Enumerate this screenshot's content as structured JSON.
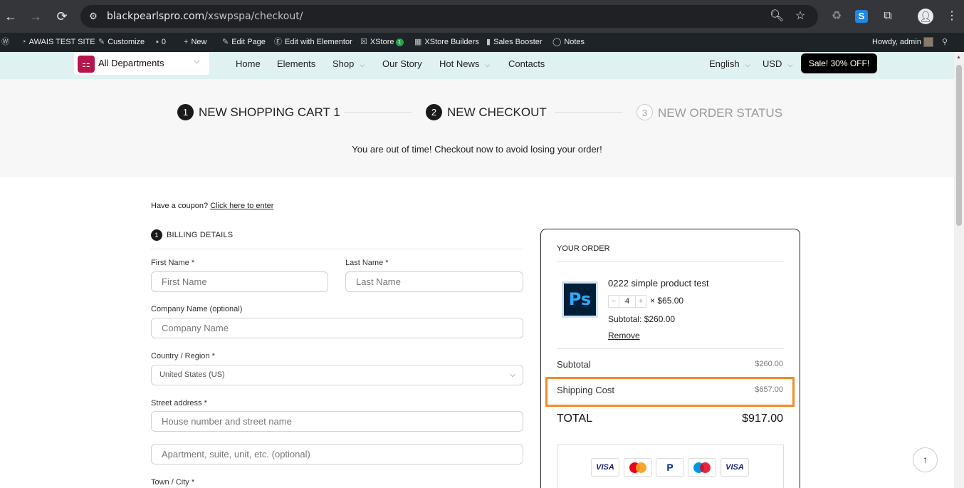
{
  "browser": {
    "url_host": "blackpearlspro.com",
    "url_path": "/xswpspa/checkout/"
  },
  "adminbar": {
    "site": "AWAIS TEST SITE",
    "customize": "Customize",
    "comments": "0",
    "new": "New",
    "edit_page": "Edit Page",
    "edit_elementor": "Edit with Elementor",
    "xstore": "XStore",
    "xstore_badge": "1",
    "builders": "XStore Builders",
    "sales_booster": "Sales Booster",
    "notes": "Notes",
    "howdy": "Howdy, admin"
  },
  "header": {
    "departments": "All Departments",
    "menu": [
      {
        "label": "Home",
        "dropdown": false
      },
      {
        "label": "Elements",
        "dropdown": false
      },
      {
        "label": "Shop",
        "dropdown": true
      },
      {
        "label": "Our Story",
        "dropdown": false
      },
      {
        "label": "Hot News",
        "dropdown": true
      },
      {
        "label": "Contacts",
        "dropdown": false
      }
    ],
    "language": "English",
    "currency": "USD",
    "sale_button": "Sale! 30% OFF!"
  },
  "steps": [
    {
      "num": "1",
      "label": "NEW SHOPPING CART 1",
      "active": true
    },
    {
      "num": "2",
      "label": "NEW CHECKOUT",
      "active": true
    },
    {
      "num": "3",
      "label": "NEW ORDER STATUS",
      "active": false
    }
  ],
  "timer_message": "You are out of time! Checkout now to avoid losing your order!",
  "coupon": {
    "text": "Have a coupon?",
    "link": "Click here to enter"
  },
  "billing": {
    "step_num": "1",
    "title": "BILLING DETAILS",
    "first_name_label": "First Name *",
    "first_name_placeholder": "First Name",
    "last_name_label": "Last Name *",
    "last_name_placeholder": "Last Name",
    "company_label": "Company Name (optional)",
    "company_placeholder": "Company Name",
    "country_label": "Country / Region *",
    "country_value": "United States (US)",
    "street_label": "Street address *",
    "street_placeholder": "House number and street name",
    "apartment_placeholder": "Apartment, suite, unit, etc. (optional)",
    "city_label": "Town / City *"
  },
  "order": {
    "title": "YOUR ORDER",
    "product_name": "0222 simple product test",
    "product_thumb": "Ps",
    "qty": "4",
    "unit_price": "× $65.00",
    "product_subtotal": "Subtotal: $260.00",
    "remove": "Remove",
    "subtotal_label": "Subtotal",
    "subtotal_value": "$260.00",
    "shipping_label": "Shipping Cost",
    "shipping_value": "$657.00",
    "total_label": "TOTAL",
    "total_value": "$917.00",
    "payment_cards": [
      "VISA",
      "mastercard",
      "paypal",
      "maestro",
      "VISA"
    ]
  },
  "colors": {
    "highlight": "#f28c28",
    "sale_button_bg": "#000000",
    "header_bg": "#dff1f1",
    "departments_icon": "#b5164e"
  }
}
